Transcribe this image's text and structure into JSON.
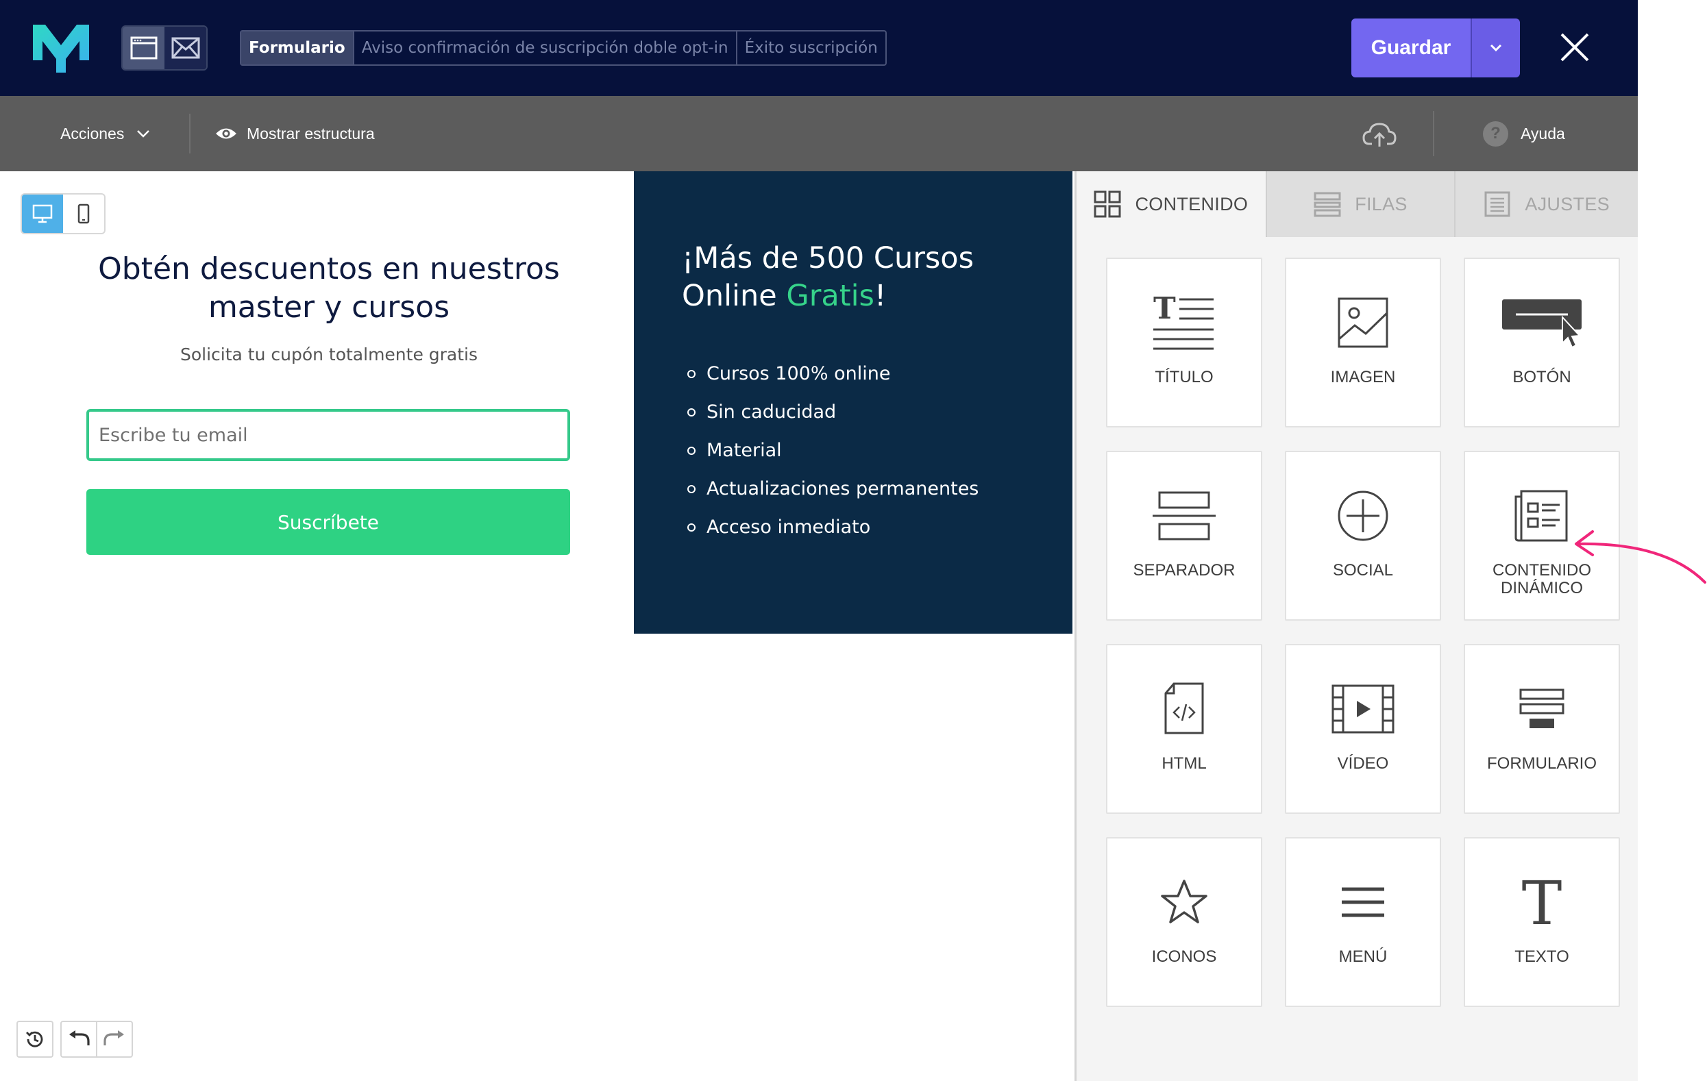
{
  "topbar": {
    "tabs": [
      {
        "label": "Formulario",
        "active": true
      },
      {
        "label": "Aviso confirmación de suscripción doble opt-in",
        "active": false
      },
      {
        "label": "Éxito suscripción",
        "active": false
      }
    ],
    "save_label": "Guardar",
    "logo_icon": "m-logo",
    "colors": {
      "background": "#06113b",
      "accent": "#7367f0",
      "logo_gradient": [
        "#2fd8c4",
        "#3ab0f0"
      ]
    }
  },
  "actionbar": {
    "actions_label": "Acciones",
    "show_structure_label": "Mostrar estructura",
    "help_label": "Ayuda",
    "help_icon_glyph": "?"
  },
  "canvas": {
    "form": {
      "title": "Obtén descuentos en nuestros master y cursos",
      "subtitle": "Solicita tu cupón totalmente gratis",
      "email_placeholder": "Escribe tu email",
      "email_value": "",
      "subscribe_label": "Suscríbete",
      "colors": {
        "button": "#2ed283",
        "input_border": "#35c98a"
      }
    },
    "promo": {
      "title_main": "¡Más de 500 Cursos Online ",
      "title_highlight": "Gratis",
      "title_end": "!",
      "items": [
        "Cursos 100% online",
        "Sin caducidad",
        "Material",
        "Actualizaciones permanentes",
        "Acceso inmediato"
      ],
      "colors": {
        "background": "#0b2a46",
        "highlight": "#36d38a"
      }
    }
  },
  "panel": {
    "tabs": [
      {
        "label": "CONTENIDO",
        "active": true
      },
      {
        "label": "FILAS",
        "active": false
      },
      {
        "label": "AJUSTES",
        "active": false
      }
    ],
    "tiles": [
      {
        "label": "TÍTULO",
        "icon": "title-icon"
      },
      {
        "label": "IMAGEN",
        "icon": "image-icon"
      },
      {
        "label": "BOTÓN",
        "icon": "button-icon"
      },
      {
        "label": "SEPARADOR",
        "icon": "separator-icon"
      },
      {
        "label": "SOCIAL",
        "icon": "social-icon"
      },
      {
        "label": "CONTENIDO DINÁMICO",
        "icon": "dynamic-content-icon"
      },
      {
        "label": "HTML",
        "icon": "html-icon"
      },
      {
        "label": "VÍDEO",
        "icon": "video-icon"
      },
      {
        "label": "FORMULARIO",
        "icon": "form-icon"
      },
      {
        "label": "ICONOS",
        "icon": "star-icon"
      },
      {
        "label": "MENÚ",
        "icon": "menu-icon"
      },
      {
        "label": "TEXTO",
        "icon": "text-icon"
      }
    ]
  },
  "annotation": {
    "icon": "pink-arrow",
    "color": "#f0267a",
    "points_to": "CONTENIDO DINÁMICO"
  }
}
